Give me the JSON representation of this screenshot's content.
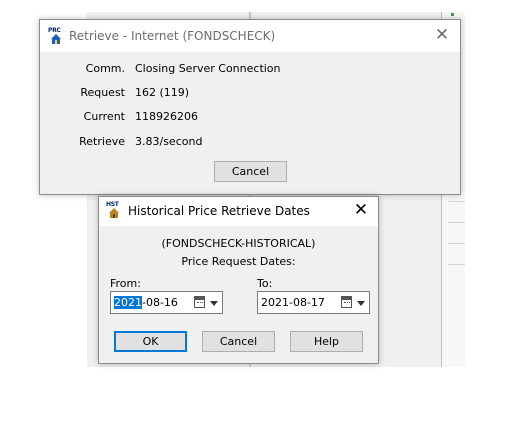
{
  "retrieve_window": {
    "title": "Retrieve - Internet (FONDSCHECK)",
    "icon_tag": "PRC",
    "rows": [
      {
        "label": "Comm.",
        "value": "Closing Server Connection"
      },
      {
        "label": "Request",
        "value": "162 (119)"
      },
      {
        "label": "Current",
        "value": "118926206"
      },
      {
        "label": "Retrieve",
        "value": "3.83/second"
      }
    ],
    "cancel_label": "Cancel"
  },
  "historical_dialog": {
    "title": "Historical Price Retrieve Dates",
    "icon_tag": "HST",
    "source": "(FONDSCHECK-HISTORICAL)",
    "subtitle": "Price Request Dates:",
    "from_label": "From:",
    "from_selected": "2021",
    "from_rest": "-08-16",
    "to_label": "To:",
    "to_value": "2021-08-17",
    "ok_label": "OK",
    "cancel_label": "Cancel",
    "help_label": "Help"
  }
}
